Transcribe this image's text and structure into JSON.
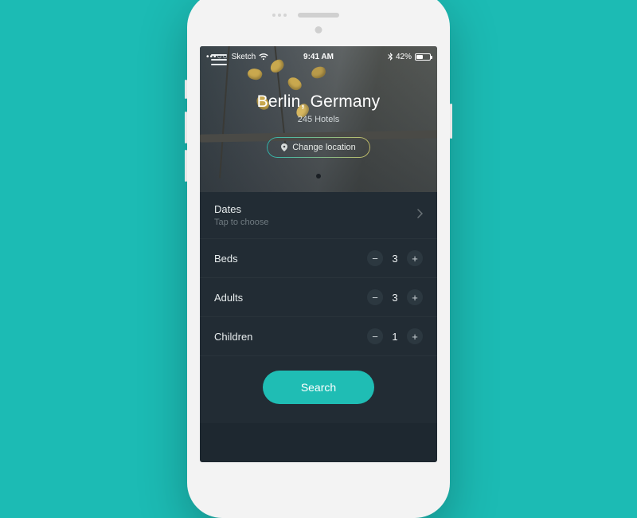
{
  "status": {
    "carrier": "Sketch",
    "signal": "•••○○",
    "time": "9:41 AM",
    "battery_pct": "42%"
  },
  "hero": {
    "location_title": "Berlin, Germany",
    "hotel_count": "245 Hotels",
    "change_location_label": "Change location"
  },
  "dates": {
    "label": "Dates",
    "hint": "Tap to choose"
  },
  "steppers": {
    "beds": {
      "label": "Beds",
      "value": "3"
    },
    "adults": {
      "label": "Adults",
      "value": "3"
    },
    "children": {
      "label": "Children",
      "value": "1"
    }
  },
  "search_label": "Search",
  "colors": {
    "accent": "#1fbdb4",
    "panel": "#222c34",
    "page_bg": "#1cbbb4"
  }
}
